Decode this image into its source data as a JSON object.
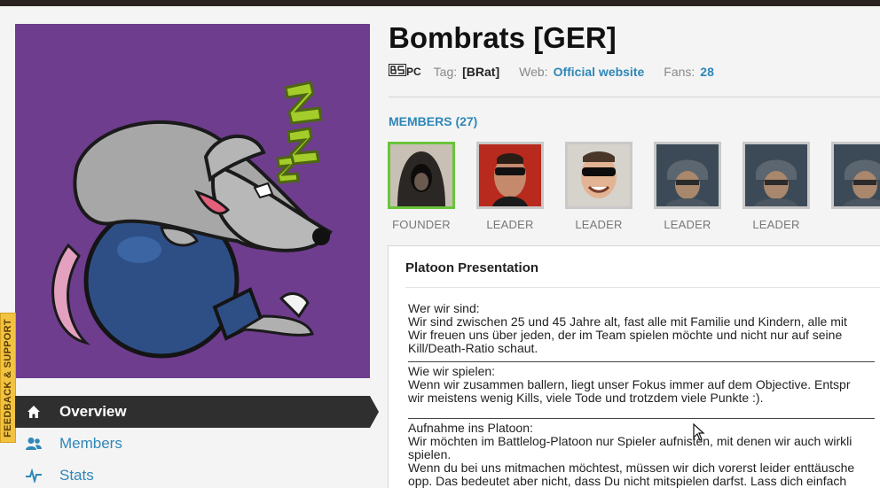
{
  "platoon": {
    "name": "Bombrats [GER]",
    "platform_label": "PC",
    "tag_label": "Tag:",
    "tag": "[BRat]",
    "web_label": "Web:",
    "web_link": "Official website",
    "fans_label": "Fans:",
    "fans": "28"
  },
  "members": {
    "heading": "MEMBERS (27)",
    "list": [
      {
        "role": "FOUNDER",
        "avatar": "hooded-figure"
      },
      {
        "role": "LEADER",
        "avatar": "man-sunglasses-red"
      },
      {
        "role": "LEADER",
        "avatar": "man-sunglasses-smiling"
      },
      {
        "role": "LEADER",
        "avatar": "soldier-helmet"
      },
      {
        "role": "LEADER",
        "avatar": "soldier-helmet"
      },
      {
        "role": "",
        "avatar": "soldier-helmet"
      }
    ]
  },
  "nav": {
    "items": [
      {
        "label": "Overview",
        "icon": "home-icon",
        "active": true
      },
      {
        "label": "Members",
        "icon": "users-icon",
        "active": false
      },
      {
        "label": "Stats",
        "icon": "pulse-icon",
        "active": false
      }
    ]
  },
  "feedback_tab": "FEEDBACK & SUPPORT",
  "presentation": {
    "title": "Platoon Presentation",
    "sections": [
      {
        "lines": [
          "Wer wir sind:",
          "Wir sind zwischen 25 und 45 Jahre alt, fast alle mit Familie und Kindern, alle mit",
          "Wir freuen uns über jeden, der im Team spielen möchte und nicht nur auf seine",
          "Kill/Death-Ratio schaut."
        ]
      },
      {
        "lines": [
          "Wie wir spielen:",
          "Wenn wir zusammen ballern, liegt unser Fokus immer auf dem Objective. Entspr",
          "wir meistens wenig Kills, viele Tode und trotzdem viele Punkte :)."
        ]
      },
      {
        "lines": [
          "Aufnahme ins Platoon:",
          "Wir möchten im Battlelog-Platoon nur Spieler aufnisten, mit denen wir auch wirkli",
          " spielen.",
          "Wenn du bei uns mitmachen möchtest, müssen wir dich vorerst leider enttäusche",
          "opp. Das bedeutet aber nicht, dass Du nicht mitspielen darfst. Lass dich einfach"
        ]
      }
    ]
  },
  "colors": {
    "accent": "#2f87b8",
    "emblem_bg": "#6e3d8e",
    "founder_border": "#69c43a",
    "nav_active": "#2f2f2f",
    "feedback": "#f2c341"
  }
}
